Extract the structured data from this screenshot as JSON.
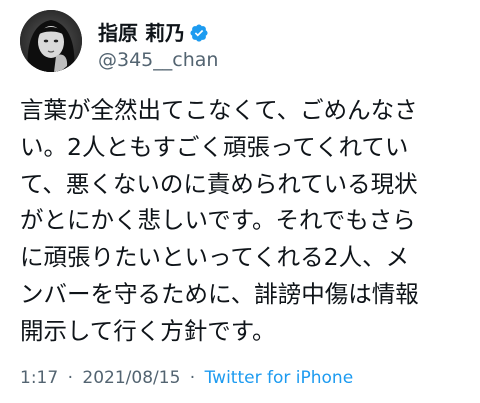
{
  "user": {
    "display_name": "指原 莉乃",
    "handle": "@345__chan",
    "verified": true,
    "avatar_icon": "avatar-photo"
  },
  "tweet": {
    "lines": [
      "言葉が全然出てこなくて、ごめんなさ",
      "い。2人ともすごく頑張ってくれてい",
      "て、悪くないのに責められている現状",
      "がとにかく悲しいです。それでもさら",
      "に頑張りたいといってくれる2人、メ",
      "ンバーを守るために、誹謗中傷は情報",
      "開示して行く方針です。"
    ]
  },
  "meta": {
    "time": "1:17",
    "separator": "·",
    "date": "2021/08/15",
    "source": "Twitter for iPhone"
  },
  "colors": {
    "text": "#0f1419",
    "secondary": "#536471",
    "link": "#1d9bf0",
    "verified_badge": "#1d9bf0"
  }
}
